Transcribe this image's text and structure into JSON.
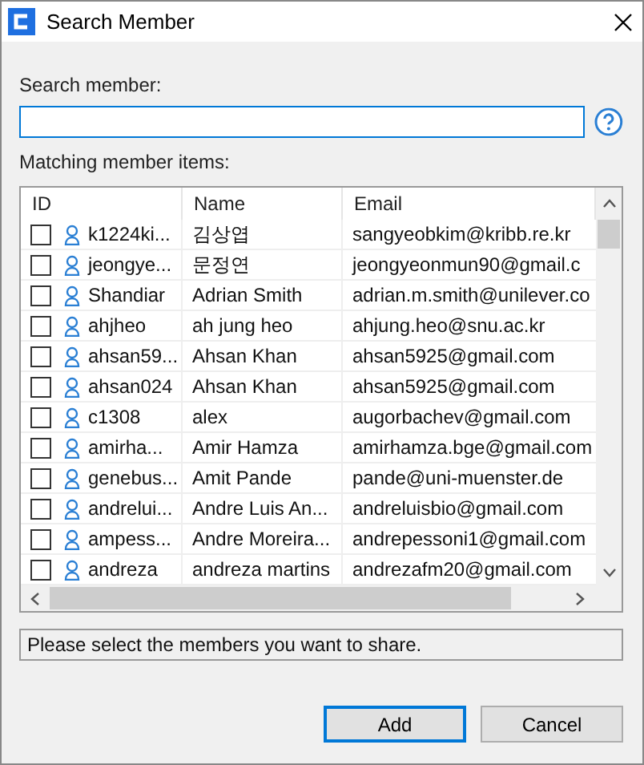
{
  "window": {
    "title": "Search Member"
  },
  "search": {
    "label": "Search member:"
  },
  "list_label": "Matching member items:",
  "table": {
    "columns": [
      "ID",
      "Name",
      "Email"
    ],
    "rows": [
      {
        "checked": false,
        "id": "k1224ki...",
        "name": "김상엽",
        "email": "sangyeobkim@kribb.re.kr"
      },
      {
        "checked": false,
        "id": "jeongye...",
        "name": "문정연",
        "email": "jeongyeonmun90@gmail.c"
      },
      {
        "checked": false,
        "id": "Shandiar",
        "name": "Adrian Smith",
        "email": "adrian.m.smith@unilever.co"
      },
      {
        "checked": false,
        "id": "ahjheo",
        "name": "ah jung heo",
        "email": "ahjung.heo@snu.ac.kr"
      },
      {
        "checked": false,
        "id": "ahsan59...",
        "name": "Ahsan Khan",
        "email": "ahsan5925@gmail.com"
      },
      {
        "checked": false,
        "id": "ahsan024",
        "name": "Ahsan Khan",
        "email": "ahsan5925@gmail.com"
      },
      {
        "checked": false,
        "id": "c1308",
        "name": "alex",
        "email": "augorbachev@gmail.com"
      },
      {
        "checked": false,
        "id": "amirha...",
        "name": "Amir Hamza",
        "email": "amirhamza.bge@gmail.com"
      },
      {
        "checked": false,
        "id": "genebus...",
        "name": "Amit Pande",
        "email": "pande@uni-muenster.de"
      },
      {
        "checked": false,
        "id": "andrelui...",
        "name": "Andre Luis An...",
        "email": "andreluisbio@gmail.com"
      },
      {
        "checked": false,
        "id": "ampess...",
        "name": "Andre Moreira...",
        "email": "andrepessoni1@gmail.com"
      },
      {
        "checked": false,
        "id": "andreza",
        "name": "andreza martins",
        "email": "andrezafm20@gmail.com"
      }
    ]
  },
  "status": "Please select the members you want to share.",
  "buttons": [
    {
      "label": "Add",
      "selected": true
    },
    {
      "label": "Cancel",
      "selected": false
    }
  ]
}
